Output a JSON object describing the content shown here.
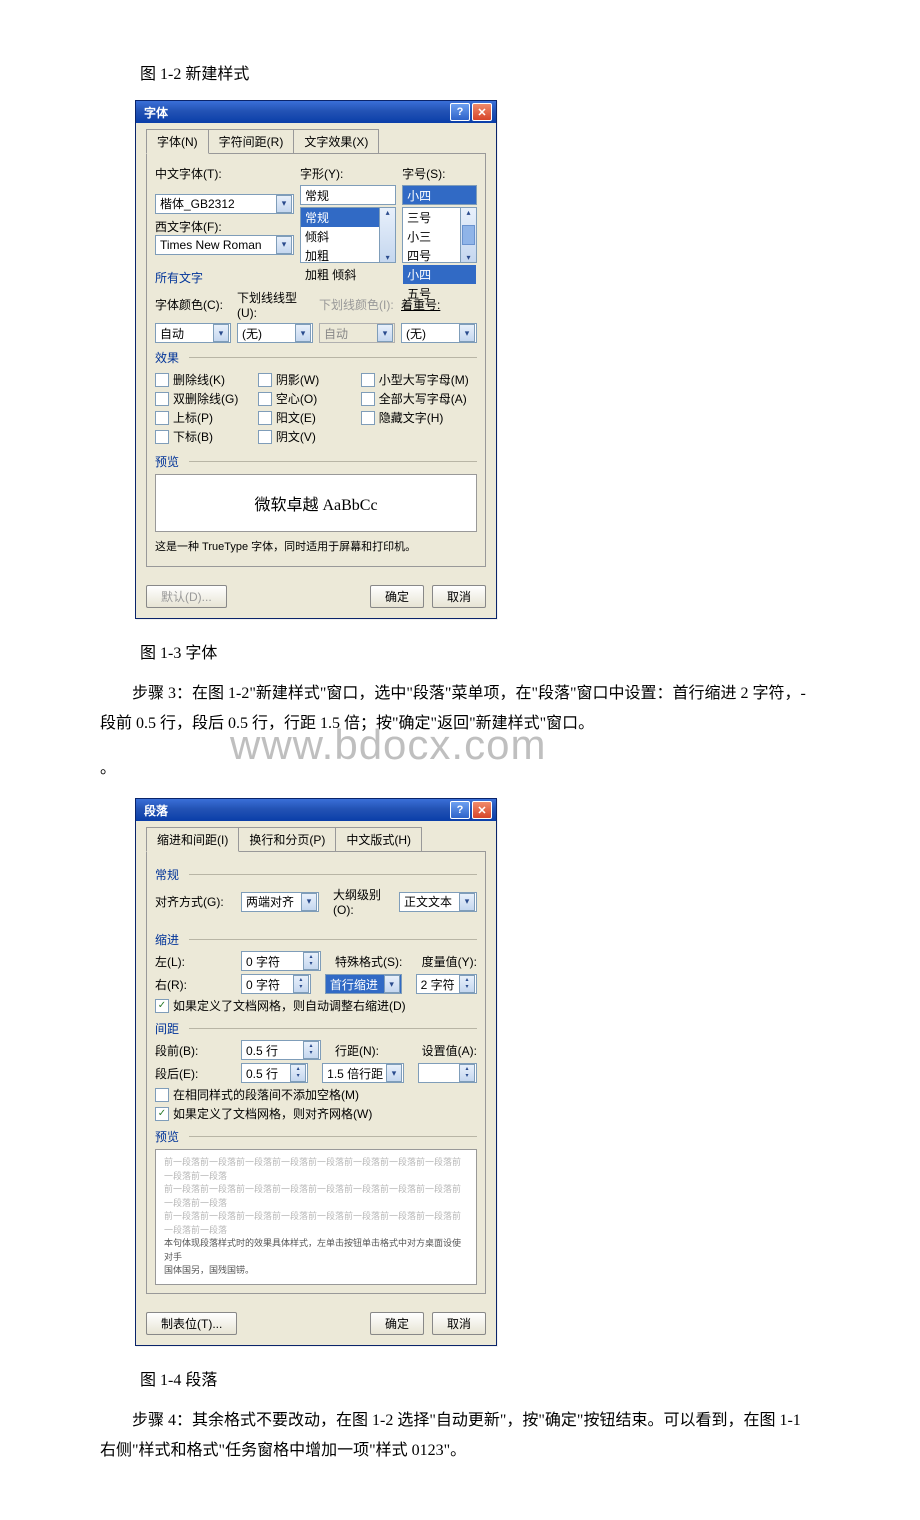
{
  "captions": {
    "fig12": "图 1-2 新建样式",
    "fig13": "图 1-3 字体",
    "fig14": "图 1-4 段落"
  },
  "paragraphs": {
    "step3": "步骤 3：在图 1-2\"新建样式\"窗口，选中\"段落\"菜单项，在\"段落\"窗口中设置：首行缩进 2 字符，-段前 0.5 行，段后 0.5 行，行距 1.5 倍；按\"确定\"返回\"新建样式\"窗口。",
    "step4": "步骤 4：其余格式不要改动，在图 1-2 选择\"自动更新\"，按\"确定\"按钮结束。可以看到，在图 1-1 右侧\"样式和格式\"任务窗格中增加一项\"样式 0123\"。"
  },
  "watermark": "www.bdocx.com",
  "fontDialog": {
    "title": "字体",
    "tabs": {
      "font": "字体(N)",
      "spacing": "字符间距(R)",
      "effects": "文字效果(X)"
    },
    "labels": {
      "cnFont": "中文字体(T):",
      "enFont": "西文字体(F):",
      "style": "字形(Y):",
      "size": "字号(S):",
      "allText": "所有文字",
      "color": "字体颜色(C):",
      "under": "下划线线型(U):",
      "underColor": "下划线颜色(I):",
      "emphasis": "着重号:",
      "fx": "效果",
      "preview": "预览"
    },
    "values": {
      "cnFont": "楷体_GB2312",
      "enFont": "Times New Roman",
      "style": "常规",
      "size": "小四",
      "color": "自动",
      "under": "(无)",
      "underColor": "自动",
      "emphasis": "(无)",
      "previewText": "微软卓越 AaBbCc"
    },
    "styleList": [
      "常规",
      "倾斜",
      "加粗",
      "加粗 倾斜"
    ],
    "sizeList": [
      "三号",
      "小三",
      "四号",
      "小四",
      "五号"
    ],
    "fx": {
      "strike": "删除线(K)",
      "dstrike": "双删除线(G)",
      "sup": "上标(P)",
      "sub": "下标(B)",
      "shadow": "阴影(W)",
      "hollow": "空心(O)",
      "emboss": "阳文(E)",
      "engrave": "阴文(V)",
      "smallcaps": "小型大写字母(M)",
      "allcaps": "全部大写字母(A)",
      "hidden": "隐藏文字(H)"
    },
    "note": "这是一种 TrueType 字体，同时适用于屏幕和打印机。",
    "buttons": {
      "default": "默认(D)...",
      "ok": "确定",
      "cancel": "取消"
    }
  },
  "paraDialog": {
    "title": "段落",
    "tabs": {
      "indent": "缩进和间距(I)",
      "break": "换行和分页(P)",
      "cjk": "中文版式(H)"
    },
    "section": {
      "general": "常规",
      "indent": "缩进",
      "spacing": "间距",
      "preview": "预览"
    },
    "labels": {
      "align": "对齐方式(G):",
      "outline": "大纲级别(O):",
      "left": "左(L):",
      "right": "右(R):",
      "special": "特殊格式(S):",
      "by": "度量值(Y):",
      "before": "段前(B):",
      "after": "段后(E):",
      "linespace": "行距(N):",
      "at": "设置值(A):"
    },
    "values": {
      "align": "两端对齐",
      "outline": "正文文本",
      "left": "0 字符",
      "right": "0 字符",
      "special": "首行缩进",
      "by": "2 字符",
      "before": "0.5 行",
      "after": "0.5 行",
      "linespace": "1.5 倍行距",
      "at": ""
    },
    "checks": {
      "gridIndent": "如果定义了文档网格，则自动调整右缩进(D)",
      "noSpace": "在相同样式的段落间不添加空格(M)",
      "gridSnap": "如果定义了文档网格，则对齐网格(W)"
    },
    "previewLines": {
      "grey": "前一段落前一段落前一段落前一段落前一段落前一段落前一段落前一段落前一段落前一段落",
      "dark": "本句体现段落样式时的效果具体样式，左单击按钮单击格式中对方桌面设使对手",
      "tail": "国体国另，国残国铹。"
    },
    "buttons": {
      "tabs": "制表位(T)...",
      "ok": "确定",
      "cancel": "取消"
    }
  }
}
